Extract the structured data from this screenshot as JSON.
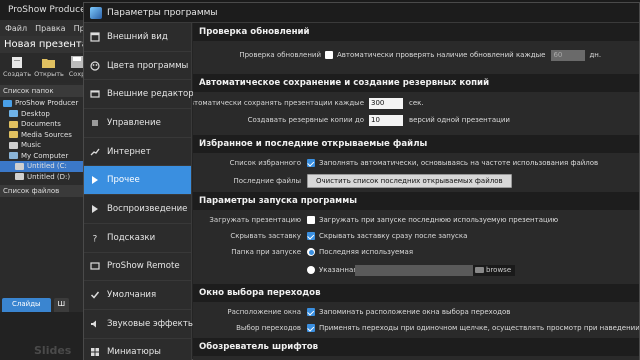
{
  "bg_app": {
    "title": "ProShow Producer - ",
    "menu": [
      "Файл",
      "Правка",
      "Презе"
    ],
    "presentation_name": "Новая презентация",
    "toolbar": [
      {
        "label": "Создать",
        "icon": "new-icon"
      },
      {
        "label": "Открыть",
        "icon": "open-icon"
      },
      {
        "label": "Сохр",
        "icon": "save-icon"
      }
    ],
    "folders_label": "Список папок",
    "tree": [
      {
        "label": "ProShow Producer",
        "icon": "app-icon"
      },
      {
        "label": "Desktop",
        "icon": "folder-icon"
      },
      {
        "label": "Documents",
        "icon": "folder-icon"
      },
      {
        "label": "Media Sources",
        "icon": "folder-icon"
      },
      {
        "label": "Music",
        "icon": "music-icon"
      },
      {
        "label": "My Computer",
        "icon": "computer-icon"
      },
      {
        "label": "Untitled (C:",
        "icon": "drive-icon",
        "selected": true
      },
      {
        "label": "Untitled (D:)",
        "icon": "drive-icon"
      }
    ],
    "files_label": "Список файлов",
    "slide_tabs": [
      "Слайды",
      "Ш"
    ],
    "slides_watermark": "Slides"
  },
  "dialog": {
    "title": "Параметры программы",
    "nav": [
      {
        "label": "Внешний вид",
        "icon": "appearance-icon",
        "active": false
      },
      {
        "label": "Цвета программы",
        "icon": "colors-icon",
        "active": false
      },
      {
        "label": "Внешние редакторы",
        "icon": "editors-icon",
        "active": false
      },
      {
        "label": "Управление",
        "icon": "control-icon",
        "active": false
      },
      {
        "label": "Интернет",
        "icon": "internet-icon",
        "active": false
      },
      {
        "label": "Прочее",
        "icon": "misc-icon",
        "active": true
      },
      {
        "label": "Воспроизведение",
        "icon": "play-icon",
        "active": false
      },
      {
        "label": "Подсказки",
        "icon": "help-icon",
        "active": false
      },
      {
        "label": "ProShow Remote",
        "icon": "remote-icon",
        "active": false
      },
      {
        "label": "Умолчания",
        "icon": "defaults-icon",
        "active": false
      },
      {
        "label": "Звуковые эффекты",
        "icon": "sound-icon",
        "active": false
      },
      {
        "label": "Миниатюры",
        "icon": "thumbs-icon",
        "active": false
      }
    ],
    "sections": {
      "updates": {
        "title": "Проверка обновлений",
        "label": "Проверка обновлений",
        "checkbox_text": "Автоматически проверять наличие обновлений каждые",
        "checked": false,
        "value": "60",
        "unit": "дн."
      },
      "autosave": {
        "title": "Автоматическое сохранение и создание резервных копий",
        "autosave_label": "Автоматически сохранять презентации каждые",
        "autosave_value": "300",
        "autosave_unit": "сек.",
        "backup_label": "Создавать резервные копии до",
        "backup_value": "10",
        "backup_unit": "версий одной презентации"
      },
      "favorites": {
        "title": "Избранное и последние открываемые файлы",
        "fav_label": "Список избранного",
        "fav_text": "Заполнять автоматически, основываясь на частоте использования файлов",
        "fav_checked": true,
        "recent_label": "Последние файлы",
        "clear_button": "Очистить список последних открываемых файлов"
      },
      "startup": {
        "title": "Параметры запуска программы",
        "load_label": "Загружать презентацию",
        "load_text": "Загружать при запуске последнюю используемую презентацию",
        "load_checked": false,
        "splash_label": "Скрывать заставку",
        "splash_text": "Скрывать заставку сразу после запуска",
        "splash_checked": true,
        "folder_label": "Папка при запуске",
        "opt_last": "Последняя используемая",
        "opt_custom": "Указанная",
        "selected": "last",
        "browse": "browse"
      },
      "transitions": {
        "title": "Окно выбора переходов",
        "pos_label": "Расположение окна",
        "pos_text": "Запоминать расположение окна выбора переходов",
        "pos_checked": true,
        "sel_label": "Выбор переходов",
        "sel_text": "Применять переходы при одиночном щелчке, осуществлять просмотр при наведении мыши",
        "sel_checked": true
      },
      "fonts": {
        "title": "Обозреватель шрифтов"
      }
    }
  }
}
